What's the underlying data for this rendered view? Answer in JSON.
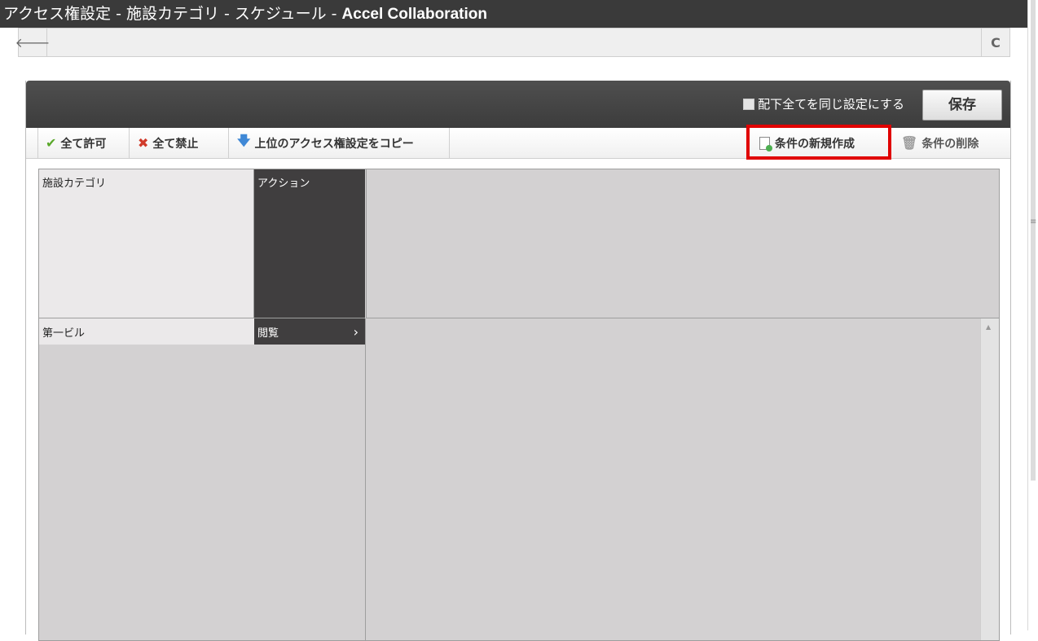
{
  "window": {
    "title_prefix": "アクセス権設定 - 施設カテゴリ - スケジュール - ",
    "title_app": "Accel Collaboration"
  },
  "nav": {
    "back_icon": "arrow-left-icon",
    "reload_icon": "reload-icon",
    "back_glyph": "🡐",
    "reload_glyph": "C"
  },
  "header": {
    "same_setting_label": "配下全てを同じ設定にする",
    "save_label": "保存"
  },
  "toolbar": {
    "allow_all_label": "全て許可",
    "deny_all_label": "全て禁止",
    "copy_parent_label": "上位のアクセス権設定をコピー",
    "new_condition_label": "条件の新規作成",
    "delete_condition_label": "条件の削除",
    "allow_all_glyph": "✔",
    "deny_all_glyph": "✖",
    "copy_parent_glyph": "🡇",
    "delete_condition_glyph": "🗑"
  },
  "table": {
    "header_category": "施設カテゴリ",
    "header_action": "アクション",
    "rows": [
      {
        "category": "第一ビル",
        "action": "閲覧",
        "chevron": "›"
      }
    ]
  },
  "colors": {
    "highlight": "#e00000",
    "panel_header": "#3c3c3c",
    "action_cell": "#403e3f",
    "grid_bg": "#d3d1d2"
  }
}
